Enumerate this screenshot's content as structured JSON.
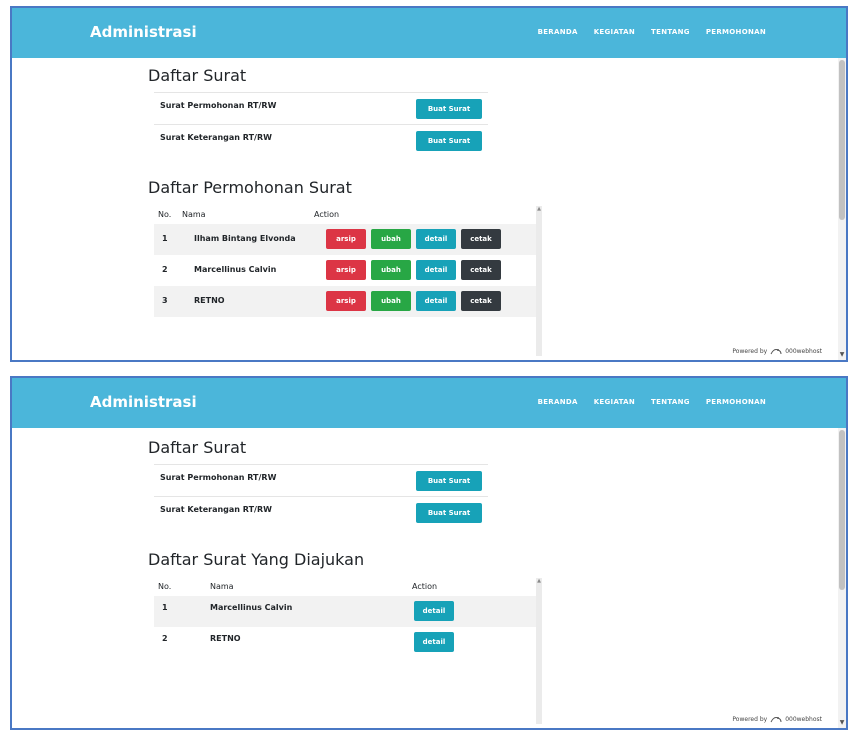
{
  "navbar": {
    "brand": "Administrasi",
    "links": [
      "BERANDA",
      "KEGIATAN",
      "TENTANG",
      "PERMOHONAN"
    ]
  },
  "daftar_surat": {
    "title": "Daftar Surat",
    "items": [
      {
        "name": "Surat Permohonan RT/RW",
        "button": "Buat Surat"
      },
      {
        "name": "Surat Keterangan RT/RW",
        "button": "Buat Surat"
      }
    ]
  },
  "admin_table": {
    "title": "Daftar Permohonan Surat",
    "columns": [
      "No.",
      "Nama",
      "Action"
    ],
    "rows": [
      {
        "no": "1",
        "nama": "Ilham Bintang Elvonda"
      },
      {
        "no": "2",
        "nama": "Marcellinus Calvin"
      },
      {
        "no": "3",
        "nama": "RETNO"
      }
    ],
    "actions": [
      "arsip",
      "ubah",
      "detail",
      "cetak"
    ]
  },
  "user_table": {
    "title": "Daftar Surat Yang Diajukan",
    "columns": [
      "No.",
      "Nama",
      "Action"
    ],
    "rows": [
      {
        "no": "1",
        "nama": "Marcellinus Calvin"
      },
      {
        "no": "2",
        "nama": "RETNO"
      }
    ],
    "action": "detail"
  },
  "footer": {
    "powered_by": "Powered by",
    "host": "000webhost"
  },
  "colors": {
    "navbar": "#4bb6da",
    "info": "#17a2b8",
    "danger": "#dc3545",
    "success": "#28a745",
    "dark": "#343a40",
    "frame": "#4a78c4"
  }
}
